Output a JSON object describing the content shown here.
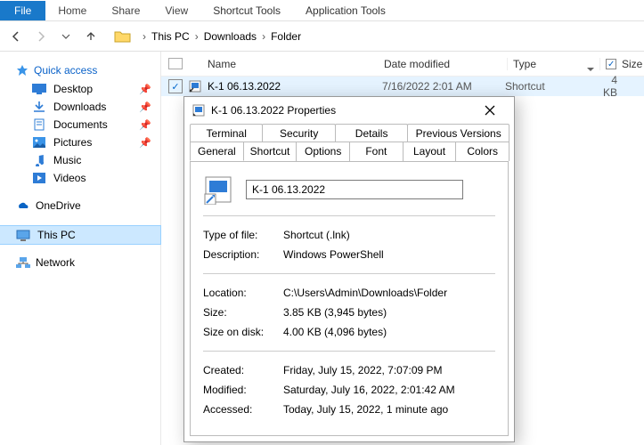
{
  "ribbon": {
    "file": "File",
    "home": "Home",
    "share": "Share",
    "view": "View",
    "shortcut_tools": "Shortcut Tools",
    "app_tools": "Application Tools"
  },
  "breadcrumb": {
    "root": "This PC",
    "p1": "Downloads",
    "p2": "Folder"
  },
  "columns": {
    "name": "Name",
    "date": "Date modified",
    "type": "Type",
    "size": "Size"
  },
  "sidebar": {
    "quick_access": "Quick access",
    "items": [
      {
        "label": "Desktop"
      },
      {
        "label": "Downloads"
      },
      {
        "label": "Documents"
      },
      {
        "label": "Pictures"
      },
      {
        "label": "Music"
      },
      {
        "label": "Videos"
      }
    ],
    "onedrive": "OneDrive",
    "this_pc": "This PC",
    "network": "Network"
  },
  "file": {
    "name": "K-1 06.13.2022",
    "date": "7/16/2022 2:01 AM",
    "type": "Shortcut",
    "size": "4 KB"
  },
  "dialog": {
    "title": "K-1 06.13.2022 Properties",
    "tabs_top": [
      "Terminal",
      "Security",
      "Details",
      "Previous Versions"
    ],
    "tabs_bottom": [
      "General",
      "Shortcut",
      "Options",
      "Font",
      "Layout",
      "Colors"
    ],
    "name_value": "K-1 06.13.2022",
    "rows": {
      "type_of_file_k": "Type of file:",
      "type_of_file_v": "Shortcut (.lnk)",
      "description_k": "Description:",
      "description_v": "Windows PowerShell",
      "location_k": "Location:",
      "location_v": "C:\\Users\\Admin\\Downloads\\Folder",
      "size_k": "Size:",
      "size_v": "3.85 KB (3,945 bytes)",
      "size_on_disk_k": "Size on disk:",
      "size_on_disk_v": "4.00 KB (4,096 bytes)",
      "created_k": "Created:",
      "created_v": "Friday, July 15, 2022, 7:07:09 PM",
      "modified_k": "Modified:",
      "modified_v": "Saturday, July 16, 2022, 2:01:42 AM",
      "accessed_k": "Accessed:",
      "accessed_v": "Today, July 15, 2022, 1 minute ago"
    }
  }
}
